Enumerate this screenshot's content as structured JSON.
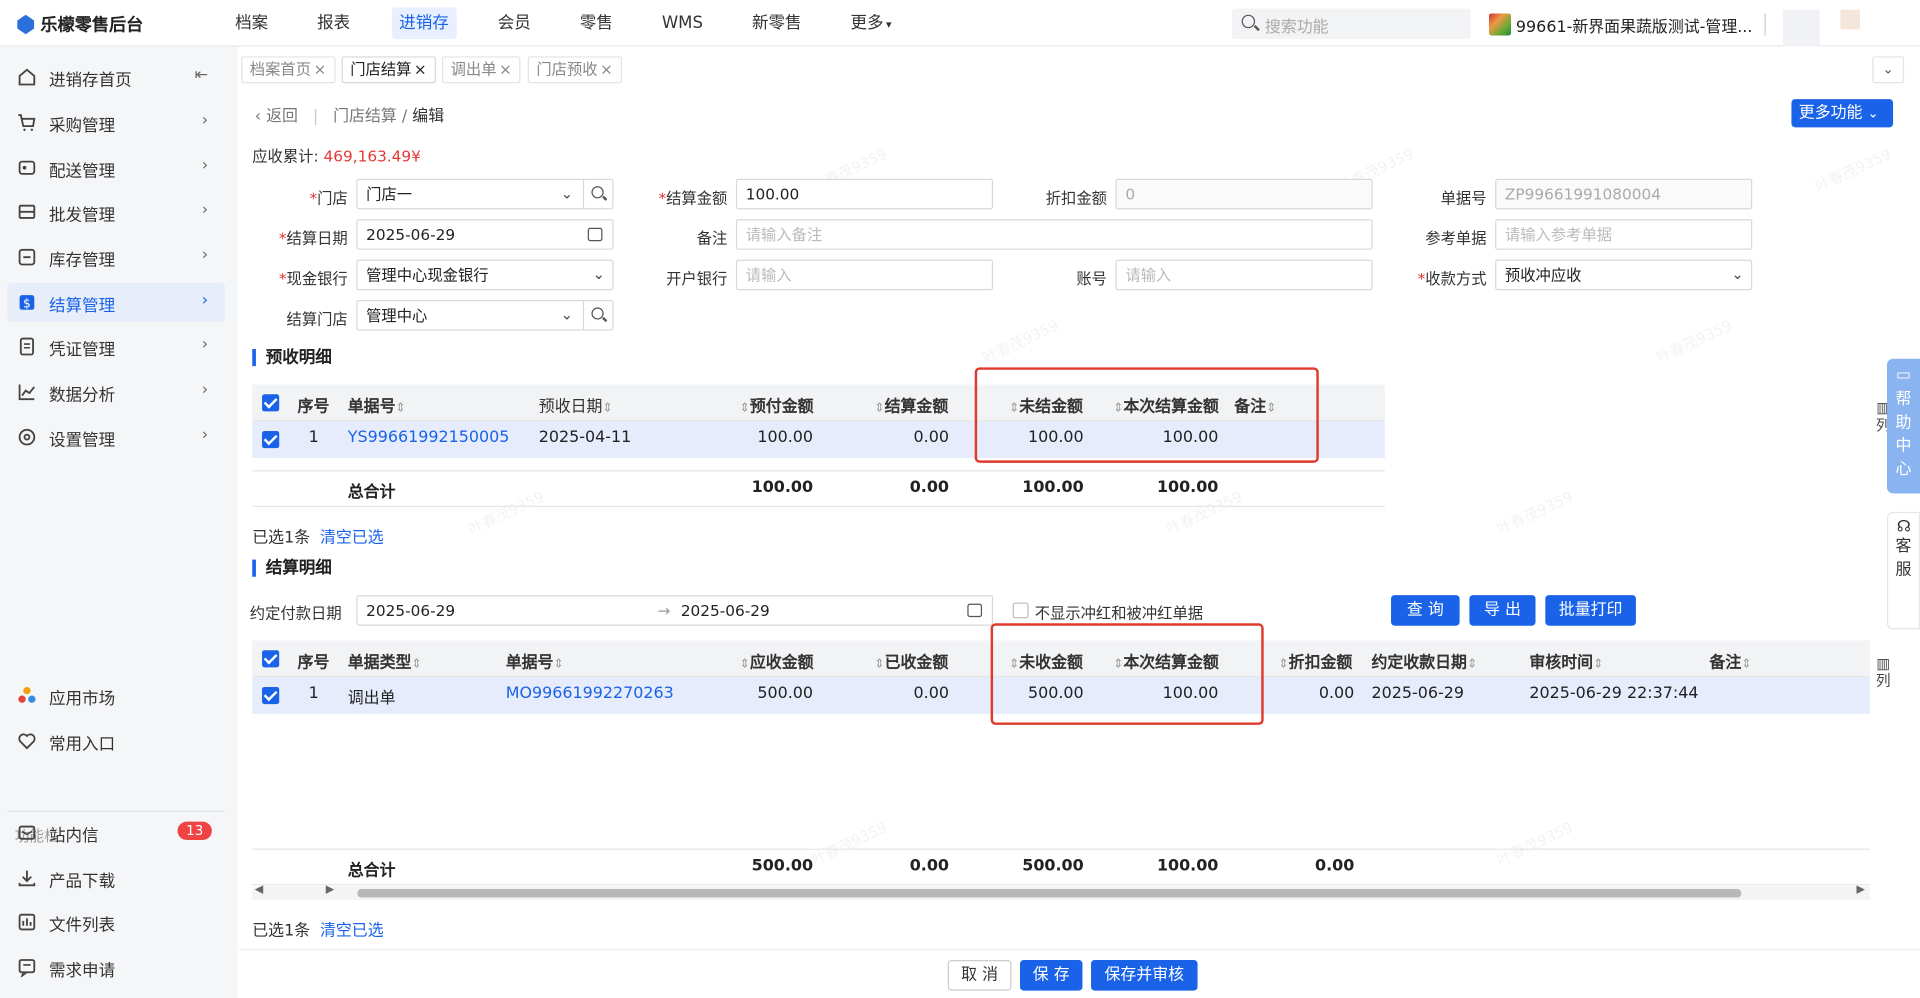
{
  "app": {
    "logo_text": "乐檬零售后台"
  },
  "topnav": {
    "items": [
      "档案",
      "报表",
      "进销存",
      "会员",
      "零售",
      "WMS",
      "新零售",
      "更多"
    ],
    "active": "进销存",
    "search_placeholder": "搜索功能",
    "store_name": "99661-新界面果蔬版测试-管理..."
  },
  "sidebar": {
    "items": [
      {
        "label": "进销存首页",
        "icon": "home-icon"
      },
      {
        "label": "采购管理",
        "icon": "cart-icon"
      },
      {
        "label": "配送管理",
        "icon": "delivery-icon"
      },
      {
        "label": "批发管理",
        "icon": "wholesale-icon"
      },
      {
        "label": "库存管理",
        "icon": "inventory-icon"
      },
      {
        "label": "结算管理",
        "icon": "settlement-icon",
        "active": true
      },
      {
        "label": "凭证管理",
        "icon": "voucher-icon"
      },
      {
        "label": "数据分析",
        "icon": "chart-icon"
      },
      {
        "label": "设置管理",
        "icon": "settings-icon"
      }
    ],
    "bottom_items": [
      {
        "label": "应用市场",
        "icon": "app-market-icon"
      },
      {
        "label": "常用入口",
        "icon": "heart-icon"
      }
    ],
    "section_label": "功能栏",
    "func_items": [
      {
        "label": "站内信",
        "icon": "mail-icon",
        "badge": "13"
      },
      {
        "label": "产品下载",
        "icon": "download-icon"
      },
      {
        "label": "文件列表",
        "icon": "file-list-icon"
      },
      {
        "label": "需求申请",
        "icon": "request-icon"
      }
    ]
  },
  "tabs": [
    {
      "label": "档案首页"
    },
    {
      "label": "门店结算",
      "active": true
    },
    {
      "label": "调出单"
    },
    {
      "label": "门店预收"
    }
  ],
  "breadcrumb": {
    "back": "返回",
    "parent": "门店结算",
    "current": "编辑"
  },
  "more_button": "更多功能",
  "receivable": {
    "label": "应收累计:",
    "value": "469,163.49¥"
  },
  "form": {
    "store_label": "门店",
    "store_value": "门店一",
    "settle_amount_label": "结算金额",
    "settle_amount_value": "100.00",
    "discount_label": "折扣金额",
    "discount_value": "0",
    "doc_no_label": "单据号",
    "doc_no_value": "ZP99661991080004",
    "settle_date_label": "结算日期",
    "settle_date_value": "2025-06-29",
    "remark_label": "备注",
    "remark_placeholder": "请输入备注",
    "ref_doc_label": "参考单据",
    "ref_doc_placeholder": "请输入参考单据",
    "cash_bank_label": "现金银行",
    "cash_bank_value": "管理中心现金银行",
    "open_bank_label": "开户银行",
    "open_bank_placeholder": "请输入",
    "account_label": "账号",
    "account_placeholder": "请输入",
    "pay_method_label": "收款方式",
    "pay_method_value": "预收冲应收",
    "settle_store_label": "结算门店",
    "settle_store_value": "管理中心"
  },
  "prepay": {
    "title": "预收明细",
    "columns": [
      "序号",
      "单据号",
      "预收日期",
      "预付金额",
      "结算金额",
      "未结金额",
      "本次结算金额",
      "备注"
    ],
    "rows": [
      {
        "idx": "1",
        "doc_no": "YS99661992150005",
        "date": "2025-04-11",
        "prepay": "100.00",
        "settled": "0.00",
        "unsettled": "100.00",
        "this_settle": "100.00",
        "remark": ""
      }
    ],
    "total_label": "总合计",
    "totals": {
      "prepay": "100.00",
      "settled": "0.00",
      "unsettled": "100.00",
      "this_settle": "100.00"
    },
    "selected": "已选1条",
    "clear": "清空已选"
  },
  "settle": {
    "title": "结算明细",
    "date_label": "约定付款日期",
    "date_from": "2025-06-29",
    "date_to": "2025-06-29",
    "hide_reverse_label": "不显示冲红和被冲红单据",
    "query_btn": "查 询",
    "export_btn": "导 出",
    "batch_print_btn": "批量打印",
    "columns": [
      "序号",
      "单据类型",
      "单据号",
      "应收金额",
      "已收金额",
      "未收金额",
      "本次结算金额",
      "折扣金额",
      "约定收款日期",
      "审核时间",
      "备注"
    ],
    "rows": [
      {
        "idx": "1",
        "type": "调出单",
        "doc_no": "MO99661992270263",
        "receivable": "500.00",
        "received": "0.00",
        "unreceived": "500.00",
        "this_settle": "100.00",
        "discount": "0.00",
        "due_date": "2025-06-29",
        "audit_time": "2025-06-29 22:37:44",
        "remark": ""
      }
    ],
    "total_label": "总合计",
    "totals": {
      "receivable": "500.00",
      "received": "0.00",
      "unreceived": "500.00",
      "this_settle": "100.00",
      "discount": "0.00"
    },
    "selected": "已选1条",
    "clear": "清空已选"
  },
  "column_setting": "列",
  "right_help": "帮助中心",
  "right_service": "客服",
  "footer": {
    "cancel": "取 消",
    "save": "保 存",
    "save_audit": "保存并审核"
  },
  "watermark": "叶春茂9359"
}
